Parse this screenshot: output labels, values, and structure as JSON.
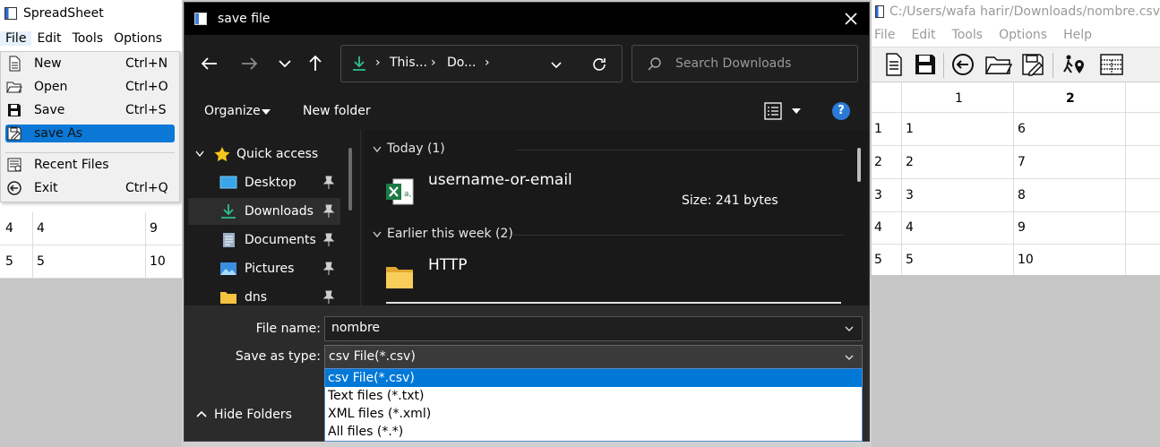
{
  "left_window": {
    "title": "SpreadSheet",
    "menus": [
      "File",
      "Edit",
      "Tools",
      "Options"
    ],
    "file_menu": [
      {
        "label": "New",
        "shortcut": "Ctrl+N",
        "icon": "new-document-icon"
      },
      {
        "label": "Open",
        "shortcut": "Ctrl+O",
        "icon": "open-folder-icon"
      },
      {
        "label": "Save",
        "shortcut": "Ctrl+S",
        "icon": "floppy-disk-icon"
      },
      {
        "label": "save As",
        "shortcut": "",
        "icon": "save-as-icon",
        "highlighted": true
      },
      {
        "label": "Recent Files",
        "shortcut": "",
        "icon": "recent-files-icon"
      },
      {
        "label": "Exit",
        "shortcut": "Ctrl+Q",
        "icon": "exit-icon"
      }
    ],
    "rows": [
      {
        "num": "4",
        "a": "4",
        "b": "9"
      },
      {
        "num": "5",
        "a": "5",
        "b": "10"
      }
    ]
  },
  "right_window": {
    "title": "C:/Users/wafa harir/Downloads/nombre.csv",
    "menus": [
      "File",
      "Edit",
      "Tools",
      "Options",
      "Help"
    ],
    "toolbar": [
      "new-document-icon",
      "floppy-disk-icon",
      "exit-icon",
      "open-folder-icon",
      "save-as-icon",
      "go-to-cell-icon",
      "table-icon"
    ],
    "col_headers": [
      "1",
      "2"
    ],
    "rows": [
      {
        "num": "1",
        "a": "1",
        "b": "6"
      },
      {
        "num": "2",
        "a": "2",
        "b": "7"
      },
      {
        "num": "3",
        "a": "3",
        "b": "8"
      },
      {
        "num": "4",
        "a": "4",
        "b": "9"
      },
      {
        "num": "5",
        "a": "5",
        "b": "10"
      }
    ]
  },
  "dialog": {
    "title": "save file",
    "address": [
      "This...",
      "Do..."
    ],
    "search_placeholder": "Search Downloads",
    "commands": {
      "organize": "Organize",
      "new_folder": "New folder"
    },
    "nav": [
      {
        "label": "Quick access",
        "icon": "star-icon",
        "pinned": false
      },
      {
        "label": "Desktop",
        "icon": "desktop-icon",
        "pinned": true
      },
      {
        "label": "Downloads",
        "icon": "download-icon",
        "pinned": true,
        "selected": true
      },
      {
        "label": "Documents",
        "icon": "documents-icon",
        "pinned": true
      },
      {
        "label": "Pictures",
        "icon": "pictures-icon",
        "pinned": true
      },
      {
        "label": "dns",
        "icon": "folder-icon",
        "pinned": true
      }
    ],
    "groups": [
      {
        "label": "Today (1)",
        "items": [
          {
            "name": "username-or-email",
            "size": "Size: 241 bytes",
            "icon": "excel-file-icon"
          }
        ]
      },
      {
        "label": "Earlier this week (2)",
        "items": [
          {
            "name": "HTTP",
            "icon": "folder-icon"
          }
        ]
      }
    ],
    "file_name_label": "File name:",
    "file_name_value": "nombre",
    "save_type_label": "Save as type:",
    "save_type_value": "csv File(*.csv)",
    "type_options": [
      "csv File(*.csv)",
      "Text files (*.txt)",
      "XML files (*.xml)",
      "All files (*.*)"
    ],
    "hide_folders": "Hide Folders",
    "colors": {
      "accent": "#0078d7",
      "dark_bg": "#1c1c1c",
      "help": "#2b7ad8"
    }
  }
}
